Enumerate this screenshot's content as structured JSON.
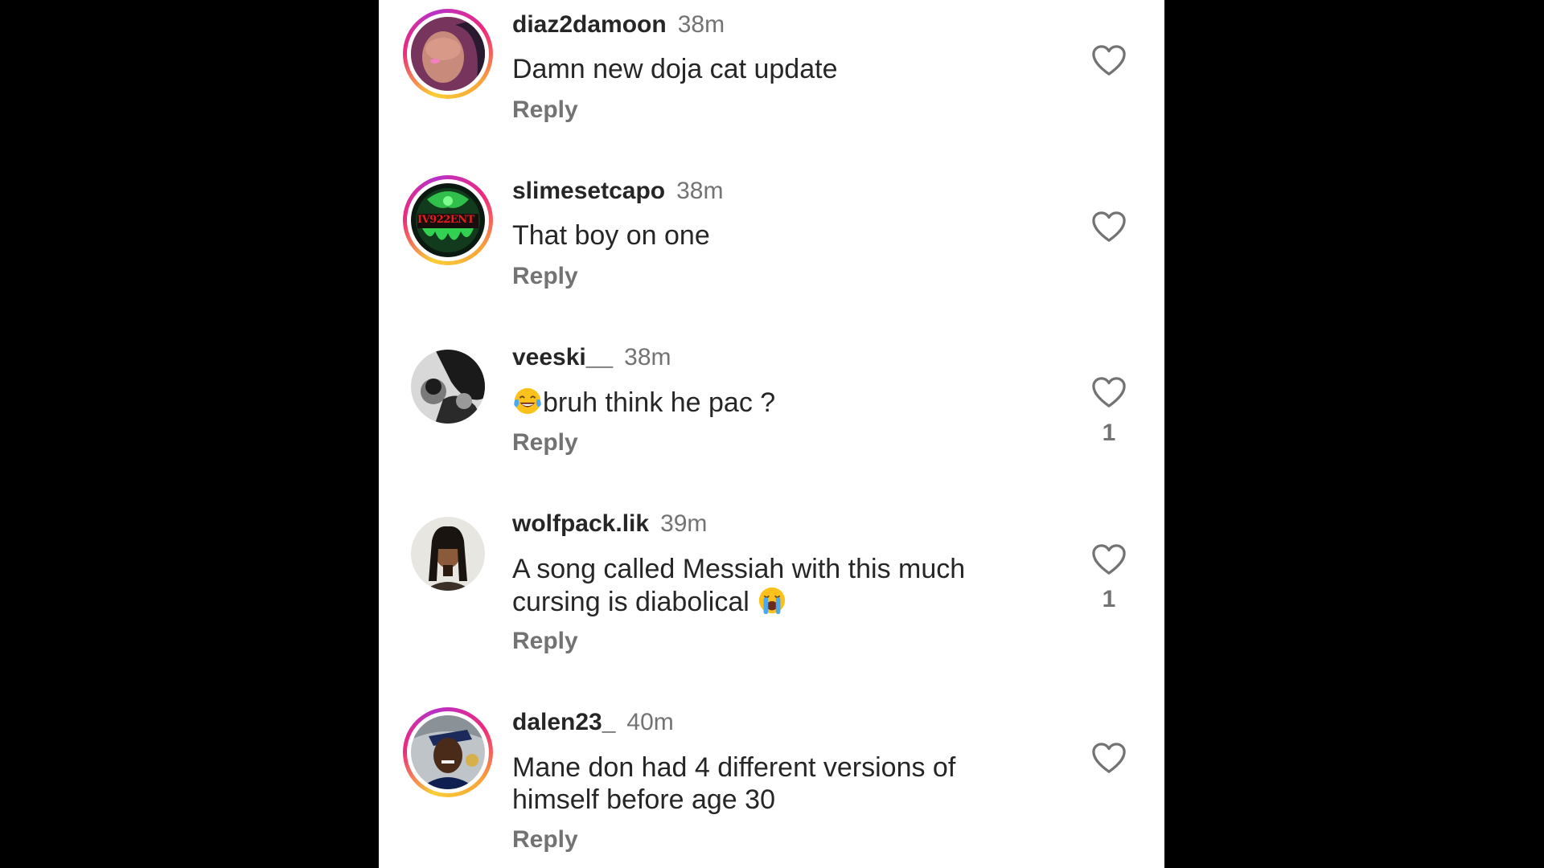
{
  "colors": {
    "background": "#000000",
    "panel": "#ffffff",
    "username": "#262626",
    "secondary": "#737373",
    "story_ring": [
      "#f9ce34",
      "#ee2a7b",
      "#b830c8"
    ]
  },
  "comments": [
    {
      "username": "diaz2damoon",
      "time": "38m",
      "text": "Damn new doja cat update",
      "reply_label": "Reply",
      "likes": "",
      "story_ring": true,
      "icon": "heart-outline-icon"
    },
    {
      "username": "slimesetcapo",
      "time": "38m",
      "text": "That boy on one",
      "reply_label": "Reply",
      "likes": "",
      "story_ring": true,
      "icon": "heart-outline-icon"
    },
    {
      "username": "veeski__",
      "time": "38m",
      "text_before_emoji": "",
      "emoji": "face-with-tears-of-joy",
      "text": "bruh think he pac ?",
      "reply_label": "Reply",
      "likes": "1",
      "story_ring": false,
      "icon": "heart-outline-icon"
    },
    {
      "username": "wolfpack.lik",
      "time": "39m",
      "text": "A song called Messiah with this much cursing is diabolical",
      "emoji": "loudly-crying-face",
      "reply_label": "Reply",
      "likes": "1",
      "story_ring": false,
      "icon": "heart-outline-icon"
    },
    {
      "username": "dalen23_",
      "time": "40m",
      "text": "Mane don had 4 different versions of himself before age 30",
      "reply_label": "Reply",
      "likes": "",
      "story_ring": true,
      "icon": "heart-outline-icon"
    }
  ]
}
